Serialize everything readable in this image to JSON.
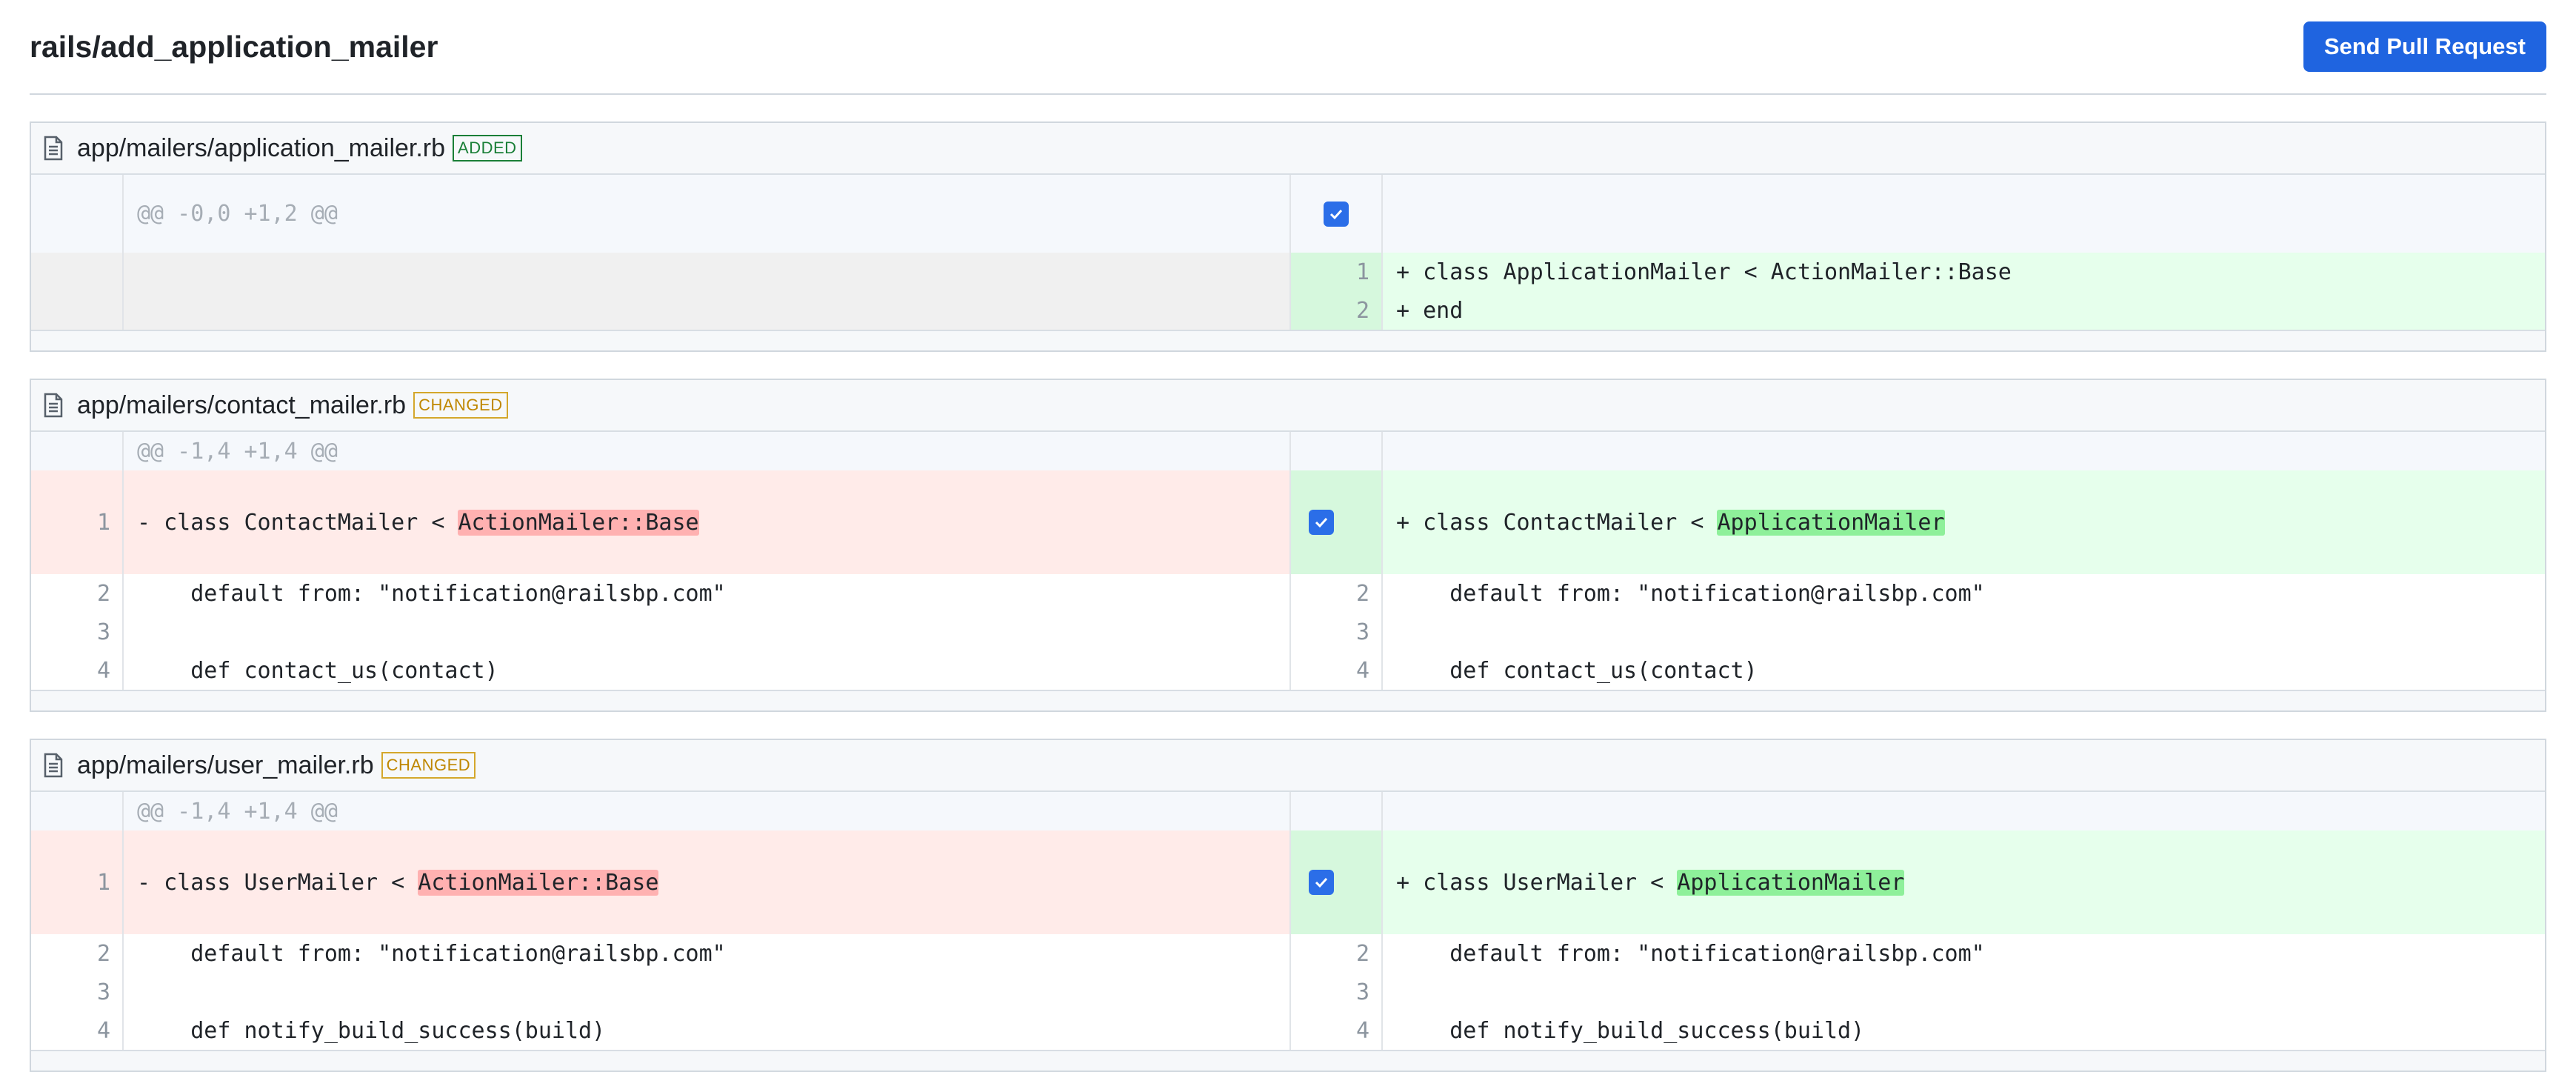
{
  "header": {
    "title": "rails/add_application_mailer",
    "send_button": "Send Pull Request"
  },
  "colors": {
    "accent": "#1f64e0",
    "added_badge": "#1a7f37",
    "changed_badge": "#bf8700",
    "added_line_bg": "#e6ffec",
    "deleted_line_bg": "#ffebe9",
    "added_highlight": "#8ef09a",
    "deleted_highlight": "#ffb1b1"
  },
  "files": [
    {
      "path": "app/mailers/application_mailer.rb",
      "status": "ADDED",
      "hunk": "@@ -0,0 +1,2 @@",
      "rows": [
        {
          "ln": "",
          "lcode": "",
          "rn": "1",
          "rcode": "+ class ApplicationMailer < ActionMailer::Base"
        },
        {
          "ln": "",
          "lcode": "",
          "rn": "2",
          "rcode": "+ end"
        }
      ]
    },
    {
      "path": "app/mailers/contact_mailer.rb",
      "status": "CHANGED",
      "hunk": "@@ -1,4 +1,4 @@",
      "rows": [
        {
          "ln": "1",
          "l_pre": "- class ContactMailer < ",
          "l_hl": "ActionMailer::Base",
          "rn": "1",
          "r_pre": "+ class ContactMailer < ",
          "r_hl": "ApplicationMailer"
        },
        {
          "ln": "2",
          "lcode": "    default from: \"notification@railsbp.com\"",
          "rn": "2",
          "rcode": "    default from: \"notification@railsbp.com\""
        },
        {
          "ln": "3",
          "lcode": "",
          "rn": "3",
          "rcode": ""
        },
        {
          "ln": "4",
          "lcode": "    def contact_us(contact)",
          "rn": "4",
          "rcode": "    def contact_us(contact)"
        }
      ]
    },
    {
      "path": "app/mailers/user_mailer.rb",
      "status": "CHANGED",
      "hunk": "@@ -1,4 +1,4 @@",
      "rows": [
        {
          "ln": "1",
          "l_pre": "- class UserMailer < ",
          "l_hl": "ActionMailer::Base",
          "rn": "1",
          "r_pre": "+ class UserMailer < ",
          "r_hl": "ApplicationMailer"
        },
        {
          "ln": "2",
          "lcode": "    default from: \"notification@railsbp.com\"",
          "rn": "2",
          "rcode": "    default from: \"notification@railsbp.com\""
        },
        {
          "ln": "3",
          "lcode": "",
          "rn": "3",
          "rcode": ""
        },
        {
          "ln": "4",
          "lcode": "    def notify_build_success(build)",
          "rn": "4",
          "rcode": "    def notify_build_success(build)"
        }
      ]
    }
  ],
  "icons": {
    "file": "file-text-icon",
    "checkbox": "checkbox-checked-icon"
  }
}
